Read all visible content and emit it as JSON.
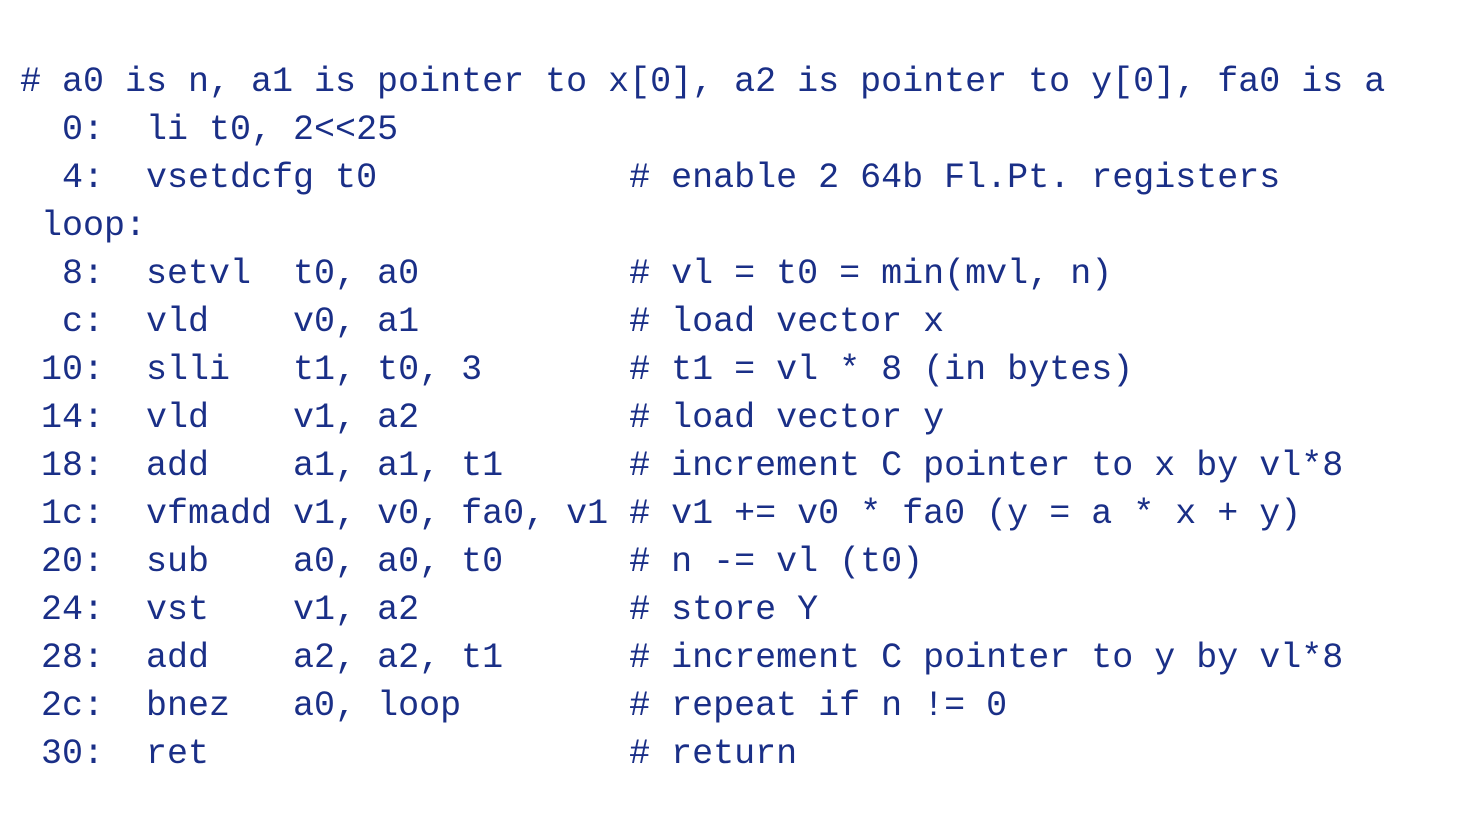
{
  "code": {
    "description_line": "# a0 is n, a1 is pointer to x[0], a2 is pointer to y[0], fa0 is a",
    "lines": [
      {
        "addr": "0",
        "colon": ":",
        "mnemonic": "li t0, 2<<25",
        "comment": ""
      },
      {
        "addr": "4",
        "colon": ":",
        "mnemonic": "vsetdcfg t0",
        "comment": "# enable 2 64b Fl.Pt. registers"
      },
      {
        "addr": "",
        "colon": "",
        "mnemonic": "loop:",
        "comment": "",
        "label_line": true
      },
      {
        "addr": "8",
        "colon": ":",
        "mnemonic": "setvl  t0, a0",
        "comment": "# vl = t0 = min(mvl, n)"
      },
      {
        "addr": "c",
        "colon": ":",
        "mnemonic": "vld    v0, a1",
        "comment": "# load vector x"
      },
      {
        "addr": "10",
        "colon": ":",
        "mnemonic": "slli   t1, t0, 3",
        "comment": "# t1 = vl * 8 (in bytes)"
      },
      {
        "addr": "14",
        "colon": ":",
        "mnemonic": "vld    v1, a2",
        "comment": "# load vector y"
      },
      {
        "addr": "18",
        "colon": ":",
        "mnemonic": "add    a1, a1, t1",
        "comment": "# increment C pointer to x by vl*8"
      },
      {
        "addr": "1c",
        "colon": ":",
        "mnemonic": "vfmadd v1, v0, fa0, v1",
        "comment": "# v1 += v0 * fa0 (y = a * x + y)"
      },
      {
        "addr": "20",
        "colon": ":",
        "mnemonic": "sub    a0, a0, t0",
        "comment": "# n -= vl (t0)"
      },
      {
        "addr": "24",
        "colon": ":",
        "mnemonic": "vst    v1, a2",
        "comment": "# store Y"
      },
      {
        "addr": "28",
        "colon": ":",
        "mnemonic": "add    a2, a2, t1",
        "comment": "# increment C pointer to y by vl*8"
      },
      {
        "addr": "2c",
        "colon": ":",
        "mnemonic": "bnez   a0, loop",
        "comment": "# repeat if n != 0"
      },
      {
        "addr": "30",
        "colon": ":",
        "mnemonic": "ret",
        "comment": "# return"
      }
    ]
  },
  "layout": {
    "mnemonic_field_width": 23
  }
}
